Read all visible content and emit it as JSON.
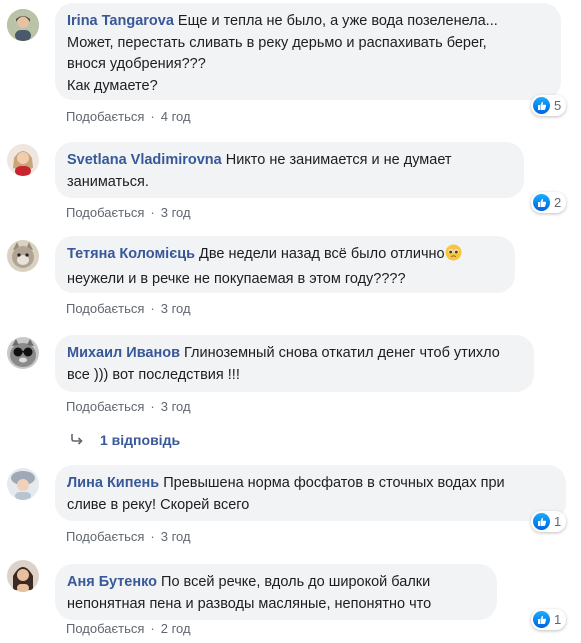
{
  "comments": [
    {
      "author": "Irina Tangarova",
      "lines": [
        "Еще и тепла не было, а уже вода позеленела...",
        "Может, перестать сливать в реку дерьмо и распахивать берег,",
        "внося удобрения???",
        "Как думаете?"
      ],
      "like_label": "Подобається",
      "time": "4 год",
      "reactions": "5",
      "avatar": "woman-outdoor-avatar"
    },
    {
      "author": "Svetlana Vladimirovna",
      "lines": [
        "Никто не занимается и не думает",
        "заниматься."
      ],
      "like_label": "Подобається",
      "time": "3 год",
      "reactions": "2",
      "avatar": "woman-red-avatar"
    },
    {
      "author": "Тетяна Коломієць",
      "lines": [
        "Две недели назад всё было отлично",
        "неужели и в речке не покупаемая в этом году????"
      ],
      "like_label": "Подобається",
      "time": "3 год",
      "reactions": "",
      "avatar": "cat-avatar"
    },
    {
      "author": "Михаил Иванов",
      "lines": [
        "Глиноземный снова откатил денег чтоб утихло",
        "все ))) вот последствия !!!"
      ],
      "like_label": "Подобається",
      "time": "3 год",
      "reactions": "",
      "avatar": "cat-sunglasses-avatar"
    },
    {
      "author": "Лина Кипень",
      "lines": [
        "Превышена норма фосфатов в сточных водах при",
        "сливе в реку! Скорей всего"
      ],
      "like_label": "Подобається",
      "time": "3 год",
      "reactions": "1",
      "avatar": "woman-hat-avatar"
    },
    {
      "author": "Аня Бутенко",
      "lines": [
        "По всей речке, вдоль до широкой балки",
        "непонятная пена и разводы масляные, непонятно что"
      ],
      "like_label": "Подобається",
      "time": "2 год",
      "reactions": "1",
      "avatar": "woman-dark-hair-avatar"
    }
  ],
  "replies_link": "1 відповідь",
  "colors": {
    "author": "#385898",
    "bubble": "#f2f3f5",
    "meta": "#606770",
    "like_blue": "#1877f2"
  },
  "icons": {
    "like": "thumbs-up-icon",
    "reply": "reply-arrow-icon",
    "emoji": "pleading-face-emoji"
  }
}
